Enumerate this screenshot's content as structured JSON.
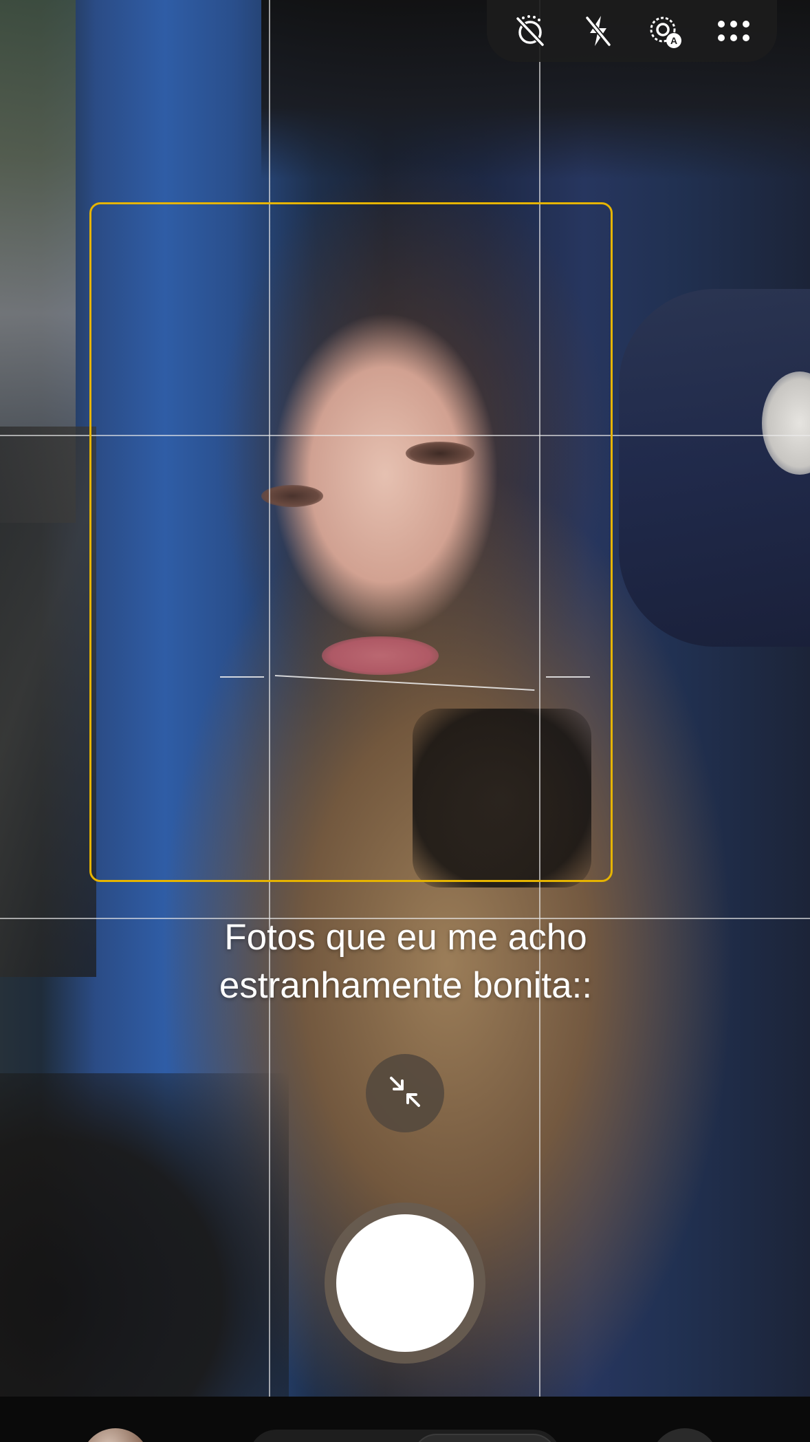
{
  "caption": {
    "line1": "Fotos que eu me acho",
    "line2": "estranhamente bonita::"
  },
  "top_bar": {
    "icons": [
      "motion-photo-off-icon",
      "flash-off-icon",
      "auto-focus-icon",
      "more-options-icon"
    ],
    "auto_badge": "A"
  },
  "controls": {
    "collapse_icon": "collapse-arrows-icon",
    "shutter": "shutter-button"
  },
  "colors": {
    "face_box": "#e6b400",
    "top_bar_bg": "#1c1c1c",
    "shutter_inner": "#ffffff",
    "shutter_ring": "#685c50",
    "collapse_bg": "#564a3e"
  }
}
